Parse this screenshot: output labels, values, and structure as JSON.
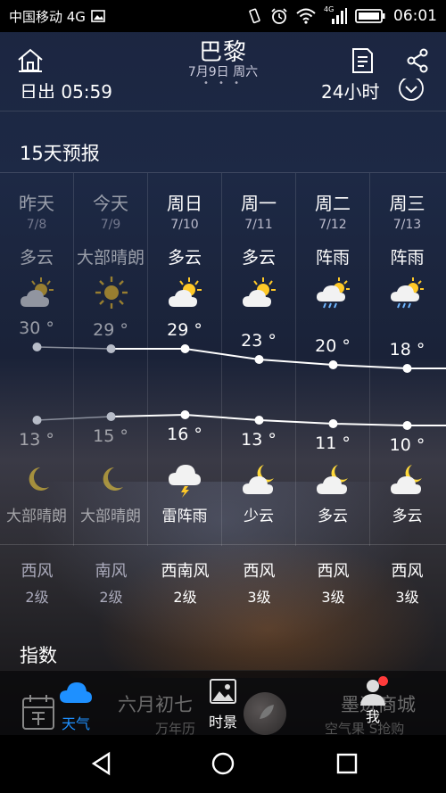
{
  "status_bar": {
    "carrier": "中国移动 4G",
    "network_badge": "4G",
    "time": "06:01"
  },
  "header": {
    "city": "巴黎",
    "date": "7月9日 周六",
    "page_dots": "• • •"
  },
  "summary": {
    "sunrise": "日出 05:59",
    "hours_label": "24小时"
  },
  "section_title": "15天预报",
  "days": [
    {
      "name": "昨天",
      "date": "7/8",
      "condition": "多云",
      "day_icon": "partly-cloudy-icon",
      "high": "30 °",
      "high_val": 30,
      "low": "13 °",
      "low_val": 13,
      "night_icon": "moon-icon",
      "night_condition": "大部晴朗",
      "wind_dir": "西风",
      "wind_level": "2级",
      "past": true
    },
    {
      "name": "今天",
      "date": "7/9",
      "condition": "大部晴朗",
      "day_icon": "sunny-icon",
      "high": "29 °",
      "high_val": 29,
      "low": "15 °",
      "low_val": 15,
      "night_icon": "moon-icon",
      "night_condition": "大部晴朗",
      "wind_dir": "南风",
      "wind_level": "2级",
      "past": true
    },
    {
      "name": "周日",
      "date": "7/10",
      "condition": "多云",
      "day_icon": "partly-cloudy-icon",
      "high": "29 °",
      "high_val": 29,
      "low": "16 °",
      "low_val": 16,
      "night_icon": "thunder-rain-icon",
      "night_condition": "雷阵雨",
      "wind_dir": "西南风",
      "wind_level": "2级",
      "past": false
    },
    {
      "name": "周一",
      "date": "7/11",
      "condition": "多云",
      "day_icon": "partly-cloudy-icon",
      "high": "23 °",
      "high_val": 23,
      "low": "13 °",
      "low_val": 13,
      "night_icon": "moon-cloud-icon",
      "night_condition": "少云",
      "wind_dir": "西风",
      "wind_level": "3级",
      "past": false
    },
    {
      "name": "周二",
      "date": "7/12",
      "condition": "阵雨",
      "day_icon": "shower-icon",
      "high": "20 °",
      "high_val": 20,
      "low": "11 °",
      "low_val": 11,
      "night_icon": "moon-cloud-icon",
      "night_condition": "多云",
      "wind_dir": "西风",
      "wind_level": "3级",
      "past": false
    },
    {
      "name": "周三",
      "date": "7/13",
      "condition": "阵雨",
      "day_icon": "shower-icon",
      "high": "18 °",
      "high_val": 18,
      "low": "10 °",
      "low_val": 10,
      "night_icon": "moon-cloud-icon",
      "night_condition": "多云",
      "wind_dir": "西风",
      "wind_level": "3级",
      "past": false
    }
  ],
  "index_title": "指数",
  "bottom_bar": {
    "weather_label": "天气",
    "lunar_date": "六月初七",
    "almanac": "万年历",
    "scenery_label": "时景",
    "shop_title": "墨迹商城",
    "shop_sub": "空气果 S抢购",
    "me_label": "我"
  },
  "colors": {
    "accent": "#1e90ff",
    "sun": "#ffc928",
    "cloud": "#f2f2f2",
    "notify": "#ff3b3b"
  }
}
